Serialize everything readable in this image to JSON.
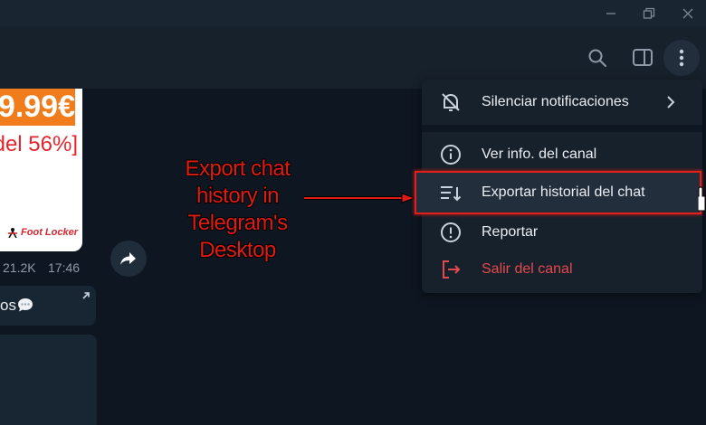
{
  "chat": {
    "price_text": "9.99€",
    "discount_text": "[del 56%]",
    "brand_text": "Foot Locker",
    "views": "21.2K",
    "time": "17:46",
    "message_snippet": "os"
  },
  "annotation": {
    "lines": [
      "Export chat",
      "history in",
      "Telegram's",
      "Desktop"
    ]
  },
  "menu": {
    "items": [
      {
        "label": "Silenciar notificaciones",
        "icon": "mute-bell-icon"
      },
      {
        "label": "Ver info. del canal",
        "icon": "info-icon"
      },
      {
        "label": "Exportar historial del chat",
        "icon": "export-list-icon"
      },
      {
        "label": "Reportar",
        "icon": "report-icon"
      },
      {
        "label": "Salir del canal",
        "icon": "leave-icon"
      }
    ]
  },
  "colors": {
    "leave": "#e5484d",
    "annotation": "#e01b14",
    "highlight_border": "#e0201c"
  }
}
